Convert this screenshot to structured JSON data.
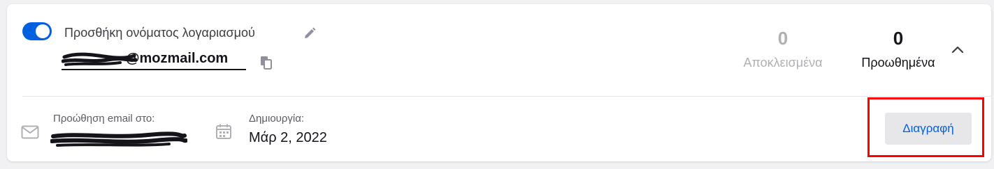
{
  "mask": {
    "enabled": true,
    "label": "Προσθήκη ονόματος λογαριασμού",
    "email_domain_visible": "@mozmail.com",
    "stats": {
      "blocked_count": "0",
      "blocked_label": "Αποκλεισμένα",
      "forwarded_count": "0",
      "forwarded_label": "Προωθημένα"
    },
    "forward_label": "Προώθηση email στο:",
    "created_label": "Δημιουργία:",
    "created_value": "Μάρ 2, 2022",
    "delete_label": "Διαγραφή"
  },
  "icons": {
    "toggle": "toggle-switch",
    "edit": "pencil-icon",
    "copy": "copy-icon",
    "collapse": "chevron-up-icon",
    "mail": "envelope-icon",
    "calendar": "calendar-icon"
  },
  "colors": {
    "accent": "#0060df",
    "highlight": "#ff0000",
    "muted": "#b0b0b5"
  }
}
